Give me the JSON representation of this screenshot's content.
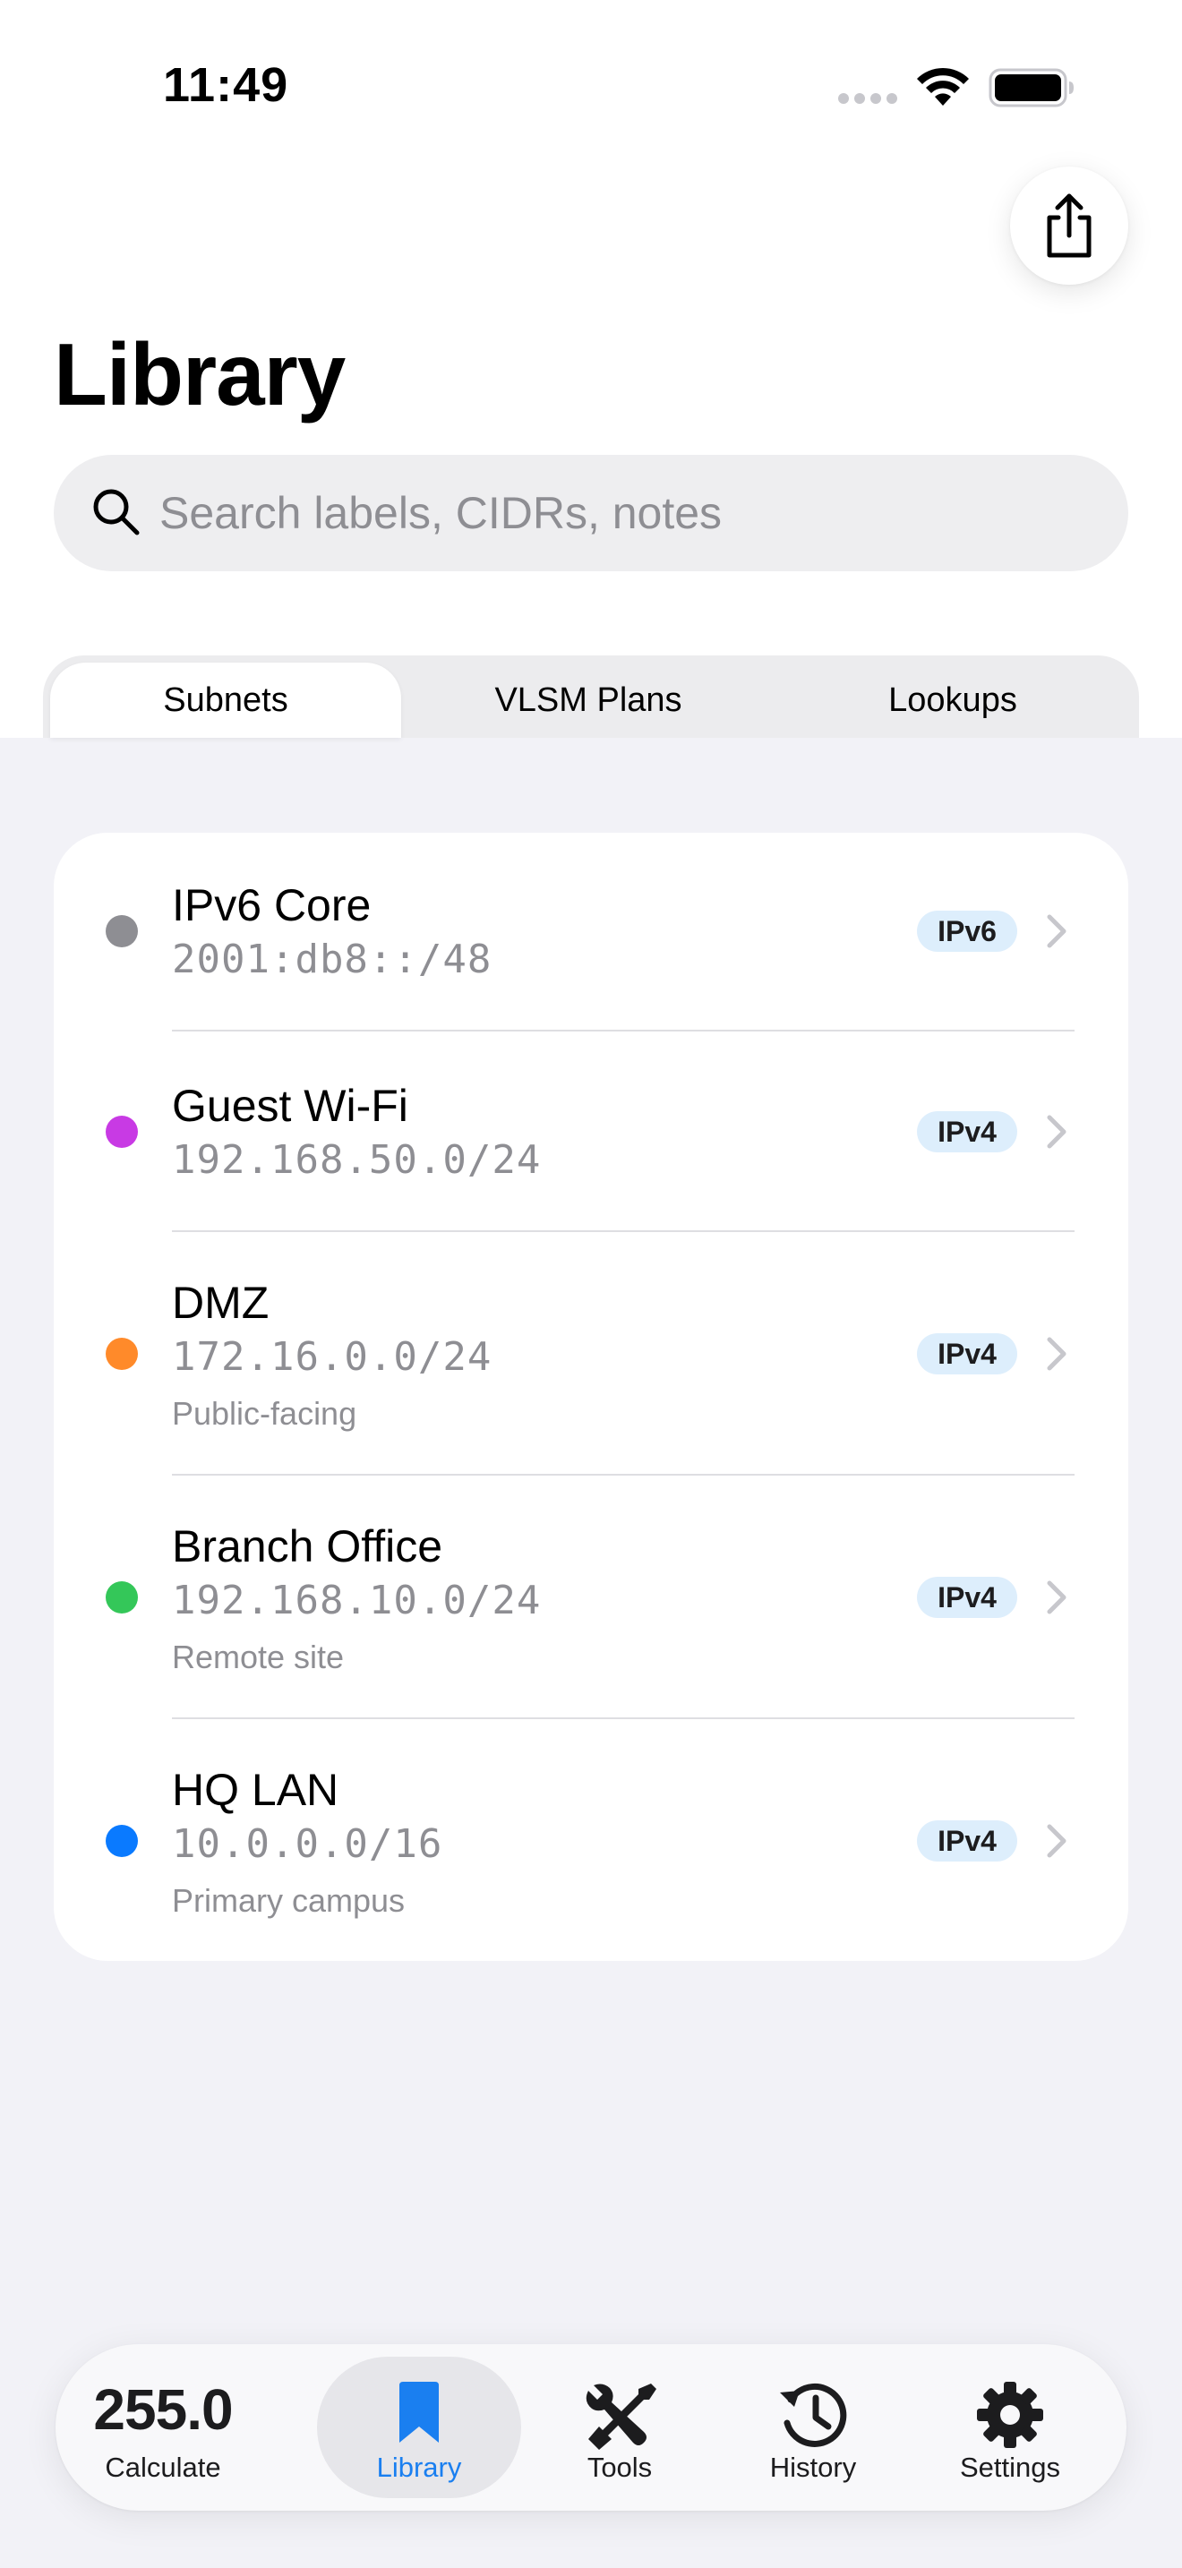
{
  "status_bar": {
    "time": "11:49"
  },
  "header": {
    "title": "Library",
    "share_icon": "share-icon"
  },
  "search": {
    "placeholder": "Search labels, CIDRs, notes",
    "value": ""
  },
  "segments": {
    "selected": "Subnets",
    "items": [
      "Subnets",
      "VLSM Plans",
      "Lookups"
    ]
  },
  "subnets": [
    {
      "title": "IPv6 Core",
      "cidr": "2001:db8::/48",
      "note": "",
      "badge": "IPv6",
      "color": "#8e8e93"
    },
    {
      "title": "Guest Wi-Fi",
      "cidr": "192.168.50.0/24",
      "note": "",
      "badge": "IPv4",
      "color": "#c83ae4"
    },
    {
      "title": "DMZ",
      "cidr": "172.16.0.0/24",
      "note": "Public-facing",
      "badge": "IPv4",
      "color": "#ff8a2a"
    },
    {
      "title": "Branch Office",
      "cidr": "192.168.10.0/24",
      "note": "Remote site",
      "badge": "IPv4",
      "color": "#34c759"
    },
    {
      "title": "HQ LAN",
      "cidr": "10.0.0.0/16",
      "note": "Primary campus",
      "badge": "IPv4",
      "color": "#0a7aff"
    }
  ],
  "tab_bar": {
    "selected": "Library",
    "accent_color": "#1a7ff0",
    "items": [
      {
        "label": "Calculate",
        "value": "255.0",
        "icon": ""
      },
      {
        "label": "Library",
        "value": "",
        "icon": "bookmark-icon"
      },
      {
        "label": "Tools",
        "value": "",
        "icon": "tools-icon"
      },
      {
        "label": "History",
        "value": "",
        "icon": "history-icon"
      },
      {
        "label": "Settings",
        "value": "",
        "icon": "gear-icon"
      }
    ]
  }
}
